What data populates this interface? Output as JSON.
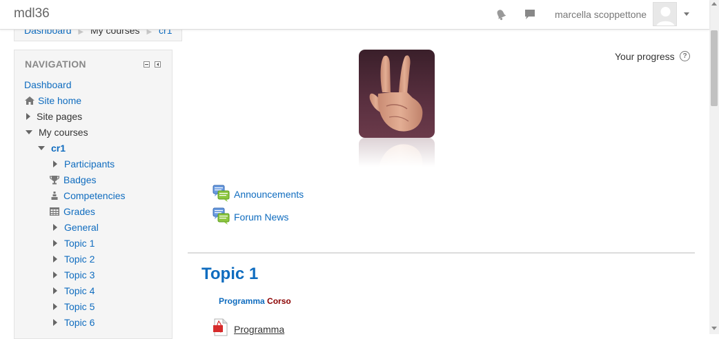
{
  "header": {
    "site_name": "mdl36",
    "user_name": "marcella scoppettone",
    "icons": [
      "bell-icon",
      "chat-icon",
      "avatar",
      "chevron-down-icon"
    ]
  },
  "breadcrumb": {
    "items": [
      "Dashboard",
      "My courses",
      "cr1"
    ]
  },
  "navigation": {
    "title": "NAVIGATION",
    "items": [
      {
        "label": "Dashboard",
        "icon": "none"
      },
      {
        "label": "Site home",
        "icon": "home-icon"
      },
      {
        "label": "Site pages",
        "icon": "caret-right-icon"
      },
      {
        "label": "My courses",
        "icon": "caret-down-icon"
      },
      {
        "label": "cr1",
        "icon": "caret-down-icon"
      },
      {
        "label": "Participants",
        "icon": "caret-right-icon"
      },
      {
        "label": "Badges",
        "icon": "trophy-icon"
      },
      {
        "label": "Competencies",
        "icon": "competency-icon"
      },
      {
        "label": "Grades",
        "icon": "table-icon"
      },
      {
        "label": "General",
        "icon": "caret-right-icon"
      },
      {
        "label": "Topic 1",
        "icon": "caret-right-icon"
      },
      {
        "label": "Topic 2",
        "icon": "caret-right-icon"
      },
      {
        "label": "Topic 3",
        "icon": "caret-right-icon"
      },
      {
        "label": "Topic 4",
        "icon": "caret-right-icon"
      },
      {
        "label": "Topic 5",
        "icon": "caret-right-icon"
      },
      {
        "label": "Topic 6",
        "icon": "caret-right-icon"
      }
    ]
  },
  "main": {
    "progress_label": "Your progress",
    "progress_help": "?",
    "activities": [
      {
        "label": "Announcements",
        "icon": "forum-icon"
      },
      {
        "label": "Forum News",
        "icon": "forum-icon"
      }
    ],
    "section": {
      "title": "Topic 1",
      "summary_part1": "Programma",
      "summary_part2": "Corso",
      "resource": {
        "label": "Programma",
        "icon": "pdf-icon"
      }
    }
  },
  "colors": {
    "link": "#0f6cbf",
    "summary_accent": "#8b0000",
    "block_bg": "#f5f5f5"
  }
}
